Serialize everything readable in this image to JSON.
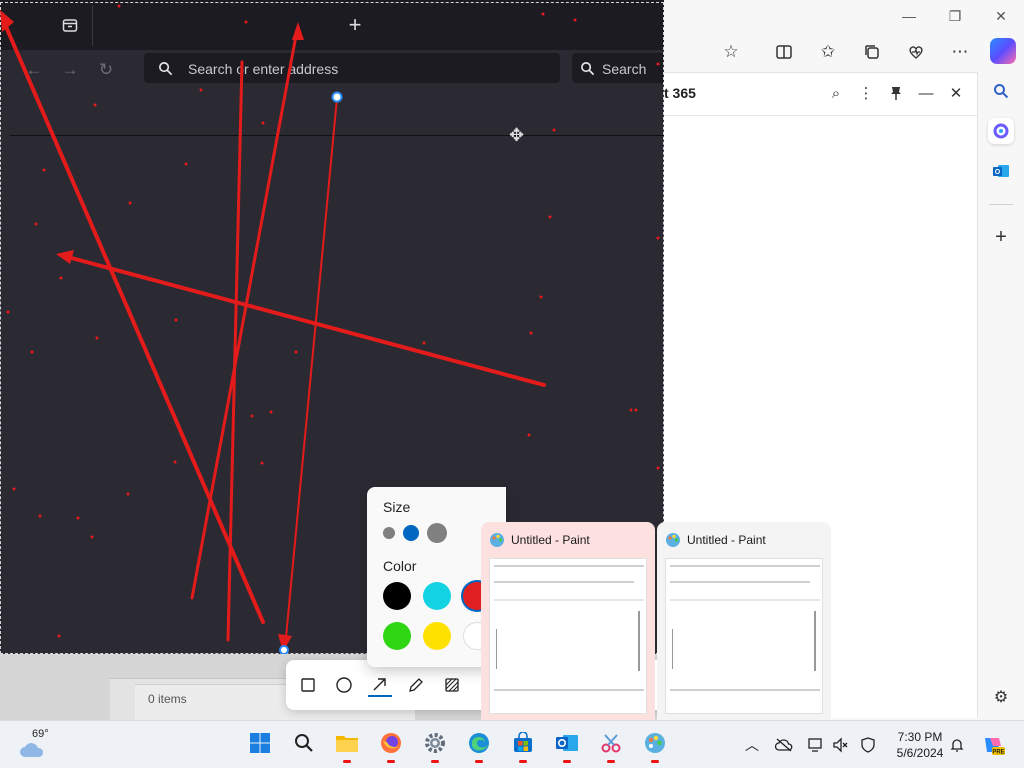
{
  "edge": {
    "sidepanel_title": "t 365"
  },
  "firefox": {
    "url_placeholder": "Search or enter address",
    "search_label": "Search",
    "explorer_items": "0 items"
  },
  "markup": {
    "size_heading": "Size",
    "color_heading": "Color",
    "colors": [
      "#000000",
      "#13d3e3",
      "#e02020",
      "#2ed614",
      "#ffe100",
      "#ffffff"
    ],
    "accent": "#0067c0"
  },
  "thumbnails": [
    {
      "title": "Untitled - Paint"
    },
    {
      "title": "Untitled - Paint"
    }
  ],
  "taskbar": {
    "weather_temp": "69°",
    "time": "7:30 PM",
    "date": "5/6/2024"
  }
}
